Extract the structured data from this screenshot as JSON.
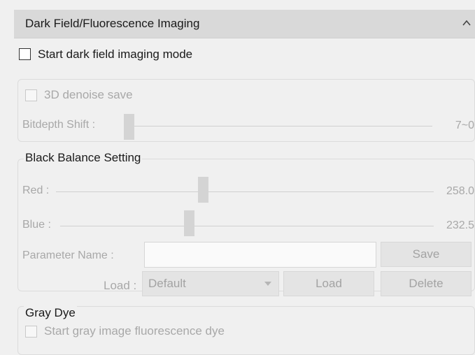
{
  "panel": {
    "title": "Dark Field/Fluorescence Imaging",
    "collapse_icon": "chevron-up-icon"
  },
  "dark_field": {
    "checkbox_label": "Start dark field imaging mode",
    "checked": false
  },
  "imaging": {
    "denoise_label": "3D denoise save",
    "denoise_checked": false,
    "bitdepth_label": "Bitdepth Shift :",
    "bitdepth_value": "7~0"
  },
  "black_balance": {
    "title": "Black Balance Setting",
    "red_label": "Red :",
    "red_value": "258.0",
    "blue_label": "Blue :",
    "blue_value": "232.5",
    "param_name_label": "Parameter Name :",
    "param_name_value": "",
    "save_label": "Save",
    "load_label": "Load :",
    "load_selected": "Default",
    "load_button": "Load",
    "delete_button": "Delete"
  },
  "gray_dye": {
    "title": "Gray Dye",
    "checkbox_label": "Start gray image fluorescence dye",
    "checked": false
  },
  "colors": {
    "header_bg": "#d9d9d9",
    "panel_bg": "#f0f0f0",
    "disabled_text": "#a8a8a8"
  }
}
